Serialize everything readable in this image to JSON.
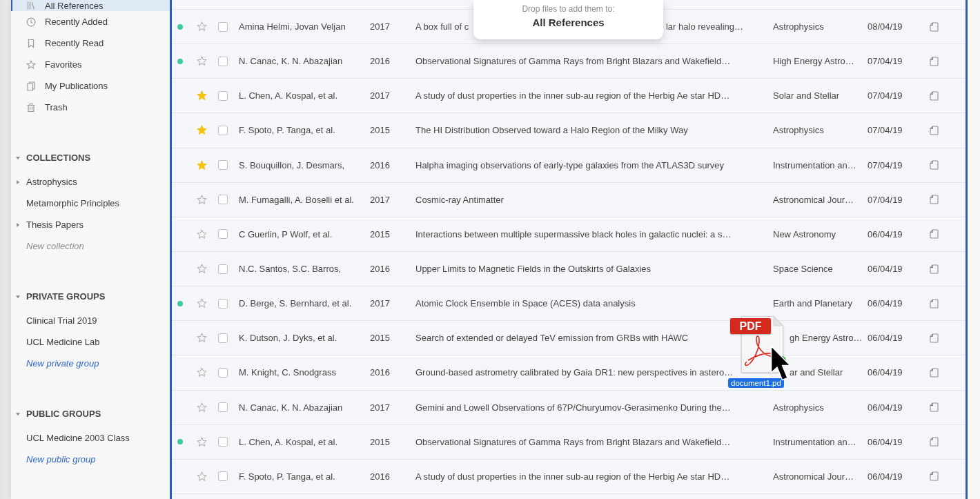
{
  "sidebar": {
    "library": [
      {
        "label": "All References",
        "selected": true
      },
      {
        "label": "Recently Added",
        "selected": false
      },
      {
        "label": "Recently Read",
        "selected": false
      },
      {
        "label": "Favorites",
        "selected": false
      },
      {
        "label": "My Publications",
        "selected": false
      },
      {
        "label": "Trash",
        "selected": false
      }
    ],
    "sections": [
      {
        "title": "COLLECTIONS",
        "expanded": true,
        "items": [
          {
            "label": "Astrophysics",
            "expanded": false
          },
          {
            "label": "Metamorphic Principles"
          },
          {
            "label": "Thesis Papers",
            "expanded": false
          }
        ],
        "new_item": {
          "label": "New collection",
          "disabled": true
        }
      },
      {
        "title": "PRIVATE GROUPS",
        "expanded": true,
        "items": [
          {
            "label": "Clinical Trial 2019"
          },
          {
            "label": "UCL Medicine Lab"
          }
        ],
        "new_item": {
          "label": "New private group",
          "disabled": false
        }
      },
      {
        "title": "PUBLIC GROUPS",
        "expanded": true,
        "items": [
          {
            "label": "UCL Medicine 2003 Class"
          }
        ],
        "new_item": {
          "label": "New public group",
          "disabled": false
        }
      }
    ]
  },
  "drop_hint": {
    "text": "Drop files to add them to:",
    "target": "All References"
  },
  "table": {
    "rows": [
      {
        "kind": "plain",
        "unread": true,
        "starred": false,
        "checked": false,
        "authors": "Amina Helmi, Jovan Veljan",
        "year": "2017",
        "title": "A box full of c",
        "title_end": "lar halo revealing…",
        "journal": "Astrophysics",
        "date": "08/04/19"
      },
      {
        "kind": "plain",
        "unread": true,
        "starred": false,
        "checked": false,
        "authors": "N. Canac, K. N. Abazajian",
        "year": "2016",
        "title": "Observational Signatures of Gamma Rays from Bright Blazars and Wakefield…",
        "journal": "High Energy Astro…",
        "date": "07/04/19"
      },
      {
        "kind": "plain",
        "unread": false,
        "starred": true,
        "checked": false,
        "authors": "L. Chen, A. Kospal, et al.",
        "year": "2017",
        "title": "A study of dust properties in the inner sub-au region of the Herbig Ae star HD…",
        "journal": "Solar and Stellar",
        "date": "07/04/19"
      },
      {
        "kind": "plain",
        "unread": false,
        "starred": true,
        "checked": false,
        "authors": "F. Spoto, P. Tanga, et al.",
        "year": "2015",
        "title": "The HI Distribution Observed toward a Halo Region of the Milky Way",
        "journal": "Astrophysics",
        "date": "07/04/19"
      },
      {
        "kind": "plain",
        "unread": false,
        "starred": true,
        "checked": false,
        "authors": "S. Bouquillon, J. Desmars,",
        "year": "2016",
        "title": "Halpha imaging observations of early-type galaxies from the ATLAS3D survey",
        "journal": "Instrumentation an…",
        "date": "07/04/19"
      },
      {
        "kind": "plain",
        "unread": false,
        "starred": false,
        "checked": false,
        "authors": "M. Fumagalli, A. Boselli et al.",
        "year": "2017",
        "title": "Cosmic-ray Antimatter",
        "journal": "Astronomical Jour…",
        "date": "07/04/19"
      },
      {
        "kind": "plain",
        "unread": false,
        "starred": false,
        "checked": false,
        "authors": "C Guerlin, P Wolf, et al.",
        "year": "2015",
        "title": "Interactions between multiple supermassive black holes in galactic nuclei: a s…",
        "journal": "New Astronomy",
        "date": "06/04/19"
      },
      {
        "kind": "plain",
        "unread": false,
        "starred": false,
        "checked": false,
        "authors": "N.C. Santos, S.C. Barros,",
        "year": "2016",
        "title": "Upper Limits to Magnetic Fields in the Outskirts of Galaxies",
        "journal": "Space Science",
        "date": "06/04/19"
      },
      {
        "kind": "plain",
        "unread": true,
        "starred": false,
        "checked": false,
        "authors": "D. Berge, S. Bernhard, et al.",
        "year": "2017",
        "title": "Atomic Clock Ensemble in Space (ACES) data analysis",
        "journal": "Earth and Planetary",
        "date": "06/04/19"
      },
      {
        "kind": "covered",
        "unread": false,
        "starred": false,
        "checked": false,
        "authors": "K. Dutson, J. Dyks, et al.",
        "year": "2015",
        "title": "Search of extended or delayed TeV emission from GRBs with HAWC",
        "journal": "gh Energy Astro…",
        "date": "06/04/19"
      },
      {
        "kind": "covered",
        "unread": false,
        "starred": false,
        "checked": false,
        "authors": "M. Knight, C. Snodgrass",
        "year": "2016",
        "title": "Ground-based astrometry calibrated by Gaia DR1: new perspectives in astero…",
        "journal": "ar and Stellar",
        "date": "06/04/19"
      },
      {
        "kind": "plain",
        "unread": false,
        "starred": false,
        "checked": false,
        "authors": "N. Canac, K. N. Abazajian",
        "year": "2017",
        "title": "Gemini and Lowell Observations of 67P/Churyumov-Gerasimenko During the…",
        "journal": "Astrophysics",
        "date": "06/04/19"
      },
      {
        "kind": "plain",
        "unread": true,
        "starred": false,
        "checked": false,
        "authors": "L. Chen, A. Kospal, et al.",
        "year": "2015",
        "title": "Observational Signatures of Gamma Rays from Bright Blazars and Wakefield…",
        "journal": "Instrumentation an…",
        "date": "06/04/19"
      },
      {
        "kind": "plain",
        "unread": false,
        "starred": false,
        "checked": false,
        "authors": "F. Spoto, P. Tanga, et al.",
        "year": "2016",
        "title": "A study of dust properties in the inner sub-au region of the Herbig Ae star HD…",
        "journal": "Astronomical Jour…",
        "date": "06/04/19"
      }
    ]
  },
  "drag_ghost": {
    "type_tag": "PDF",
    "file_name": "document1.pd"
  }
}
